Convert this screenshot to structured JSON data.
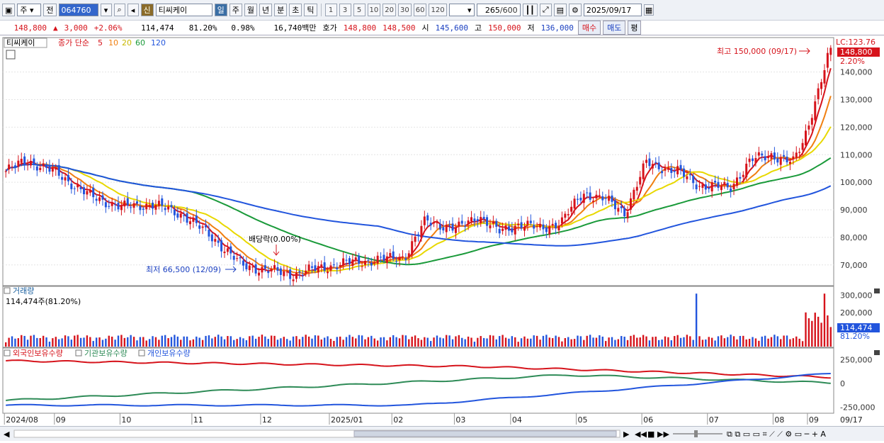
{
  "toolbar": {
    "market": "주",
    "prev_label": "전",
    "stock_code": "064760",
    "new_badge": "신",
    "stock_name": "티씨케이",
    "periods": [
      "일",
      "주",
      "월",
      "년",
      "분",
      "초",
      "틱"
    ],
    "minute_options": [
      "1",
      "3",
      "5",
      "10",
      "20",
      "30",
      "60",
      "120"
    ],
    "count_value": "265",
    "count_total": "/600",
    "date": "2025/09/17"
  },
  "quote": {
    "price": "148,800",
    "change": "3,000",
    "change_pct": "+2.06%",
    "volume": "114,474",
    "volume_ratio": "81.20%",
    "turnover": "0.98%",
    "amount": "16,740백만",
    "bid_label": "호가",
    "bid": "148,800",
    "ask": "148,500",
    "open_label": "시",
    "open": "145,600",
    "high_label": "고",
    "high": "150,000",
    "low_label": "저",
    "low": "136,000",
    "buy_label": "매수",
    "sell_label": "매도",
    "eval_label": "평"
  },
  "legend": {
    "name": "티씨케이",
    "ma_title": "종가 단순",
    "periods": [
      "5",
      "10",
      "20",
      "60",
      "120"
    ],
    "colors": [
      "#d6131b",
      "#f07f10",
      "#e8d800",
      "#1a9a3a",
      "#2255dd"
    ],
    "lc_label": "LC:123.76",
    "last_tag": "148,800",
    "pct_tag": "2.20%",
    "high_note": "최고 150,000 (09/17)",
    "low_note": "최저 66,500 (12/09)",
    "div_note": "배당락(0.00%)"
  },
  "volume_panel": {
    "title": "거래량",
    "info": "114,474주(81.20%)",
    "last_tag": "114,474",
    "pct_tag": "81.20%"
  },
  "holding_panel": {
    "series": [
      "외국인보유수량",
      "기관보유수량",
      "개인보유수량"
    ],
    "colors": [
      "#d6131b",
      "#2e8b57",
      "#2255dd"
    ]
  },
  "chart_data": {
    "type": "candlestick",
    "price_axis": [
      "140,000",
      "130,000",
      "120,000",
      "110,000",
      "100,000",
      "90,000",
      "80,000",
      "70,000"
    ],
    "price_ylim": [
      63000,
      152000
    ],
    "volume_axis": [
      "300,000",
      "200,000",
      "100,000"
    ],
    "holding_axis": [
      "250,000",
      "0",
      "-250,000"
    ],
    "x_labels": [
      "2024/08",
      "09",
      "10",
      "11",
      "12",
      "2025/01",
      "02",
      "03",
      "04",
      "05",
      "06",
      "07",
      "08",
      "09",
      "09/17"
    ],
    "price_path": [
      [
        0,
        104000
      ],
      [
        10,
        108000
      ],
      [
        25,
        103000
      ],
      [
        40,
        95000
      ],
      [
        55,
        91000
      ],
      [
        70,
        92000
      ],
      [
        85,
        88000
      ],
      [
        100,
        79000
      ],
      [
        112,
        70000
      ],
      [
        125,
        68000
      ],
      [
        137,
        66500
      ],
      [
        150,
        69000
      ],
      [
        165,
        71000
      ],
      [
        180,
        72000
      ],
      [
        190,
        73000
      ],
      [
        200,
        86000
      ],
      [
        215,
        83000
      ],
      [
        225,
        88000
      ],
      [
        235,
        82000
      ],
      [
        245,
        85000
      ],
      [
        255,
        83000
      ],
      [
        265,
        86000
      ],
      [
        275,
        96000
      ],
      [
        285,
        94000
      ],
      [
        295,
        89000
      ],
      [
        305,
        107000
      ],
      [
        320,
        104000
      ],
      [
        330,
        99000
      ],
      [
        345,
        98000
      ],
      [
        355,
        108000
      ],
      [
        365,
        110000
      ],
      [
        375,
        107000
      ],
      [
        380,
        115000
      ],
      [
        385,
        128000
      ],
      [
        390,
        141000
      ],
      [
        393,
        148800
      ]
    ],
    "ma_periods": [
      5,
      10,
      20,
      60,
      120
    ],
    "last_close": 148800,
    "high": 150000,
    "low": 66500
  }
}
